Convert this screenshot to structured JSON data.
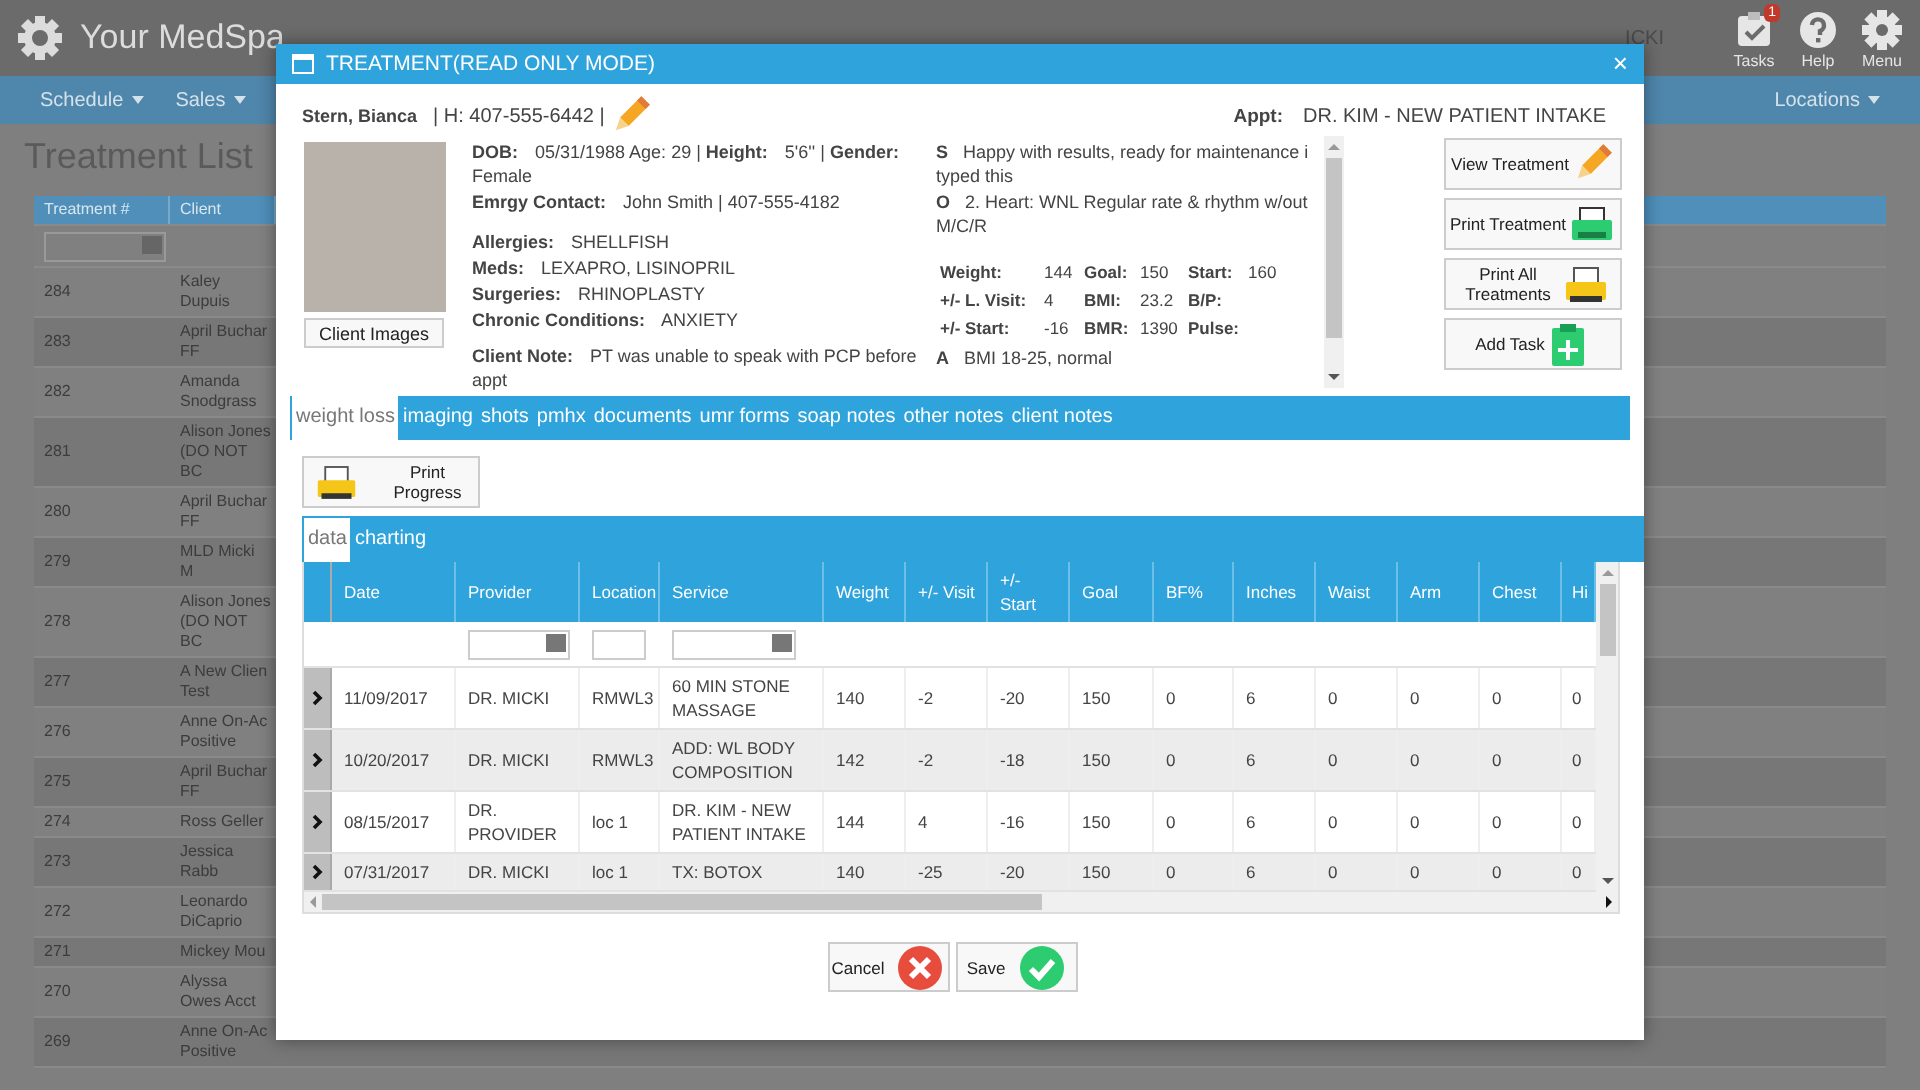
{
  "header": {
    "app_name": "Your MedSpa",
    "user_text": "ICKI",
    "icons": [
      {
        "kind": "tasks",
        "label": "Tasks",
        "badge": "1"
      },
      {
        "kind": "help",
        "label": "Help"
      },
      {
        "kind": "menu",
        "label": "Menu"
      }
    ]
  },
  "nav": {
    "items": [
      "Schedule",
      "Sales"
    ],
    "right": "Locations"
  },
  "page_title": "Treatment List",
  "list": {
    "columns": [
      "Treatment #",
      "Client"
    ],
    "rows": [
      {
        "number": "284",
        "client": "Kaley Dupuis"
      },
      {
        "number": "283",
        "client": "April Buchar FF"
      },
      {
        "number": "282",
        "client": "Amanda Snodgrass"
      },
      {
        "number": "281",
        "client": "Alison Jones (DO NOT BC"
      },
      {
        "number": "280",
        "client": "April Buchar FF"
      },
      {
        "number": "279",
        "client": "MLD Micki M"
      },
      {
        "number": "278",
        "client": "Alison Jones (DO NOT BC"
      },
      {
        "number": "277",
        "client": "A New Clien Test"
      },
      {
        "number": "276",
        "client": "Anne On-Ac Positive"
      },
      {
        "number": "275",
        "client": "April Buchar FF"
      },
      {
        "number": "274",
        "client": "Ross Geller"
      },
      {
        "number": "273",
        "client": "Jessica Rabb"
      },
      {
        "number": "272",
        "client": "Leonardo DiCaprio"
      },
      {
        "number": "271",
        "client": "Mickey Mou"
      },
      {
        "number": "270",
        "client": "Alyssa Owes Acct"
      },
      {
        "number": "269",
        "client": "Anne On-Ac Positive"
      }
    ]
  },
  "modal": {
    "title": "TREATMENT(READ ONLY MODE)",
    "close": "×",
    "patient_name": "Stern, Bianca",
    "phone": "| H: 407-555-6442 |",
    "appt_label": "Appt:",
    "appt_value": "DR. KIM - NEW PATIENT INTAKE",
    "client_images_button": "Client Images",
    "details": [
      "**DOB:** 05/31/1988 Age: 29 | **Height:** 5'6'' | **Gender:** Female",
      "**Emrgy Contact:** John Smith | 407-555-4182"
    ],
    "medical": [
      "**Allergies:** SHELLFISH",
      "**Meds:** LEXAPRO, LISINOPRIL",
      "**Surgeries:** RHINOPLASTY",
      "**Chronic Conditions:** ANXIETY"
    ],
    "client_note": "**Client Note:** PT was unable to speak with PCP before appt",
    "soap": {
      "subjective": "**S** Happy with results, ready for maintenance i typed this",
      "objective": "**O** 2. Heart: WNL Regular rate & rhythm w/out M/C/R",
      "vitals": [
        {
          "label": "Weight:",
          "value": "144"
        },
        {
          "label": "Goal:",
          "value": "150"
        },
        {
          "label": "Start:",
          "value": "160"
        },
        {
          "label": "+/- L. Visit:",
          "value": "4"
        },
        {
          "label": "BMI:",
          "value": "23.2"
        },
        {
          "label": "B/P:"
        },
        {
          "label": "+/- Start:",
          "value": "-16"
        },
        {
          "label": "BMR:",
          "value": "1390"
        },
        {
          "label": "Pulse:"
        }
      ],
      "assessment": "**A** BMI 18-25, normal"
    },
    "actions": [
      {
        "kind": "edit",
        "label": "View Treatment"
      },
      {
        "kind": "print",
        "label": "Print Treatment"
      },
      {
        "kind": "print-all",
        "label": "Print All Treatments"
      },
      {
        "kind": "task",
        "label": "Add Task"
      }
    ],
    "tabs": [
      {
        "label": "weight loss",
        "selected": true
      },
      {
        "label": "imaging",
        "selected": false
      },
      {
        "label": "shots",
        "selected": false
      },
      {
        "label": "pmhx",
        "selected": false
      },
      {
        "label": "documents",
        "selected": false
      },
      {
        "label": "umr forms",
        "selected": false
      },
      {
        "label": "soap notes",
        "selected": false
      },
      {
        "label": "other notes",
        "selected": false
      },
      {
        "label": "client notes",
        "selected": false
      }
    ],
    "print_progress": "Print Progress",
    "subtabs": [
      {
        "label": "data",
        "selected": true
      },
      {
        "label": "charting",
        "selected": false
      }
    ],
    "grid": {
      "columns": [
        {
          "label": "Date",
          "kind": "plain"
        },
        {
          "label": "Provider",
          "kind": "picker"
        },
        {
          "label": "Location",
          "kind": "text"
        },
        {
          "label": "Service",
          "kind": "picker"
        },
        {
          "label": "Weight",
          "kind": "plain"
        },
        {
          "label": "+/- Visit",
          "kind": "plain"
        },
        {
          "label": "+/- Start",
          "kind": "plain"
        },
        {
          "label": "Goal",
          "kind": "plain"
        },
        {
          "label": "BF%",
          "kind": "plain"
        },
        {
          "label": "Inches",
          "kind": "plain"
        },
        {
          "label": "Waist",
          "kind": "plain"
        },
        {
          "label": "Arm",
          "kind": "plain"
        },
        {
          "label": "Chest",
          "kind": "plain"
        },
        {
          "label": "Hi",
          "kind": "plain"
        }
      ],
      "rows": [
        [
          "11/09/2017",
          "DR. MICKI",
          "RMWL3",
          "60 MIN STONE MASSAGE",
          "140",
          "-2",
          "-20",
          "150",
          "0",
          "6",
          "0",
          "0",
          "0",
          "0"
        ],
        [
          "10/20/2017",
          "DR. MICKI",
          "RMWL3",
          "ADD: WL BODY COMPOSITION",
          "142",
          "-2",
          "-18",
          "150",
          "0",
          "6",
          "0",
          "0",
          "0",
          "0"
        ],
        [
          "08/15/2017",
          "DR. PROVIDER",
          "loc 1",
          "DR. KIM - NEW PATIENT INTAKE",
          "144",
          "4",
          "-16",
          "150",
          "0",
          "6",
          "0",
          "0",
          "0",
          "0"
        ],
        [
          "07/31/2017",
          "DR. MICKI",
          "loc 1",
          "TX: BOTOX",
          "140",
          "-25",
          "-20",
          "150",
          "0",
          "6",
          "0",
          "0",
          "0",
          "0"
        ]
      ]
    },
    "footer_buttons": [
      {
        "kind": "cancel",
        "label": "Cancel"
      },
      {
        "kind": "save",
        "label": "Save"
      }
    ]
  }
}
